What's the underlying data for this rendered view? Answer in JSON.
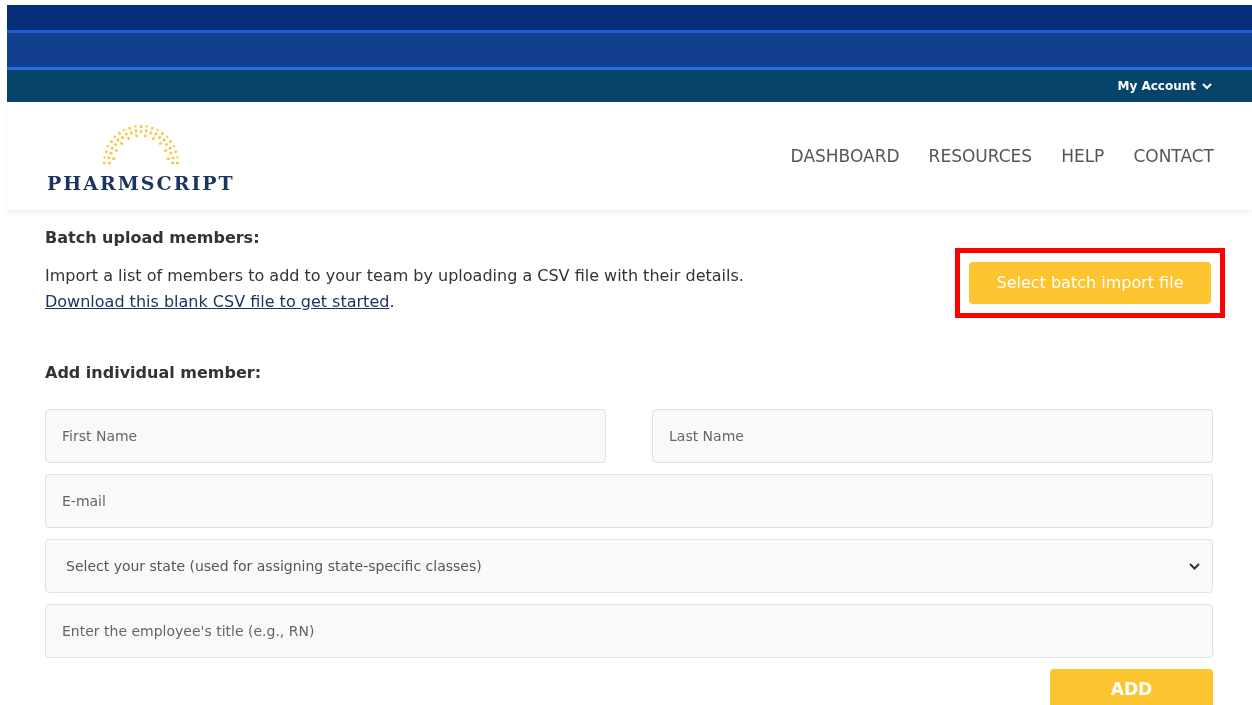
{
  "account_menu": {
    "label": "My Account"
  },
  "logo": {
    "text": "PHARMSCRIPT"
  },
  "nav": [
    {
      "label": "DASHBOARD"
    },
    {
      "label": "RESOURCES"
    },
    {
      "label": "HELP"
    },
    {
      "label": "CONTACT"
    }
  ],
  "batch": {
    "heading": "Batch upload members:",
    "description": "Import a list of members to add to your team by uploading a CSV file with their details.",
    "link": "Download this blank CSV file to get started",
    "link_suffix": ".",
    "button": "Select batch import file",
    "highlighted": true
  },
  "individual": {
    "heading": "Add individual member:",
    "fields": [
      {
        "kind": "text",
        "placeholder": "First Name"
      },
      {
        "kind": "text",
        "placeholder": "Last Name"
      },
      {
        "kind": "text",
        "placeholder": "E-mail"
      },
      {
        "kind": "select",
        "placeholder": "Select your state (used for assigning state-specific classes)"
      },
      {
        "kind": "text",
        "placeholder": "Enter the employee's title (e.g., RN)"
      }
    ],
    "button": "ADD"
  }
}
